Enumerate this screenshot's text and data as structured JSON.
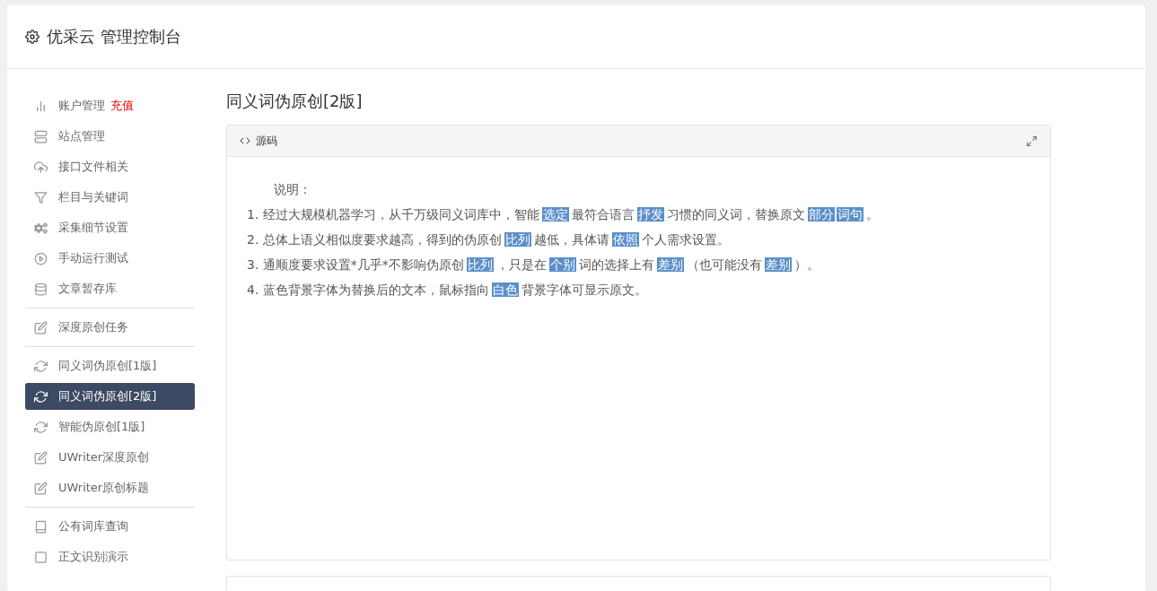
{
  "header": {
    "title": "优采云 管理控制台"
  },
  "sidebar": {
    "groups": [
      {
        "items": [
          {
            "label": "账户管理",
            "badge": "充值",
            "selected": false
          },
          {
            "label": "站点管理",
            "selected": false
          },
          {
            "label": "接口文件相关",
            "selected": false
          },
          {
            "label": "栏目与关键词",
            "selected": false
          },
          {
            "label": "采集细节设置",
            "selected": false
          },
          {
            "label": "手动运行测试",
            "selected": false
          },
          {
            "label": "文章暂存库",
            "selected": false
          }
        ]
      },
      {
        "items": [
          {
            "label": "深度原创任务",
            "selected": false
          }
        ]
      },
      {
        "items": [
          {
            "label": "同义词伪原创[1版]",
            "selected": false
          },
          {
            "label": "同义词伪原创[2版]",
            "selected": true
          },
          {
            "label": "智能伪原创[1版]",
            "selected": false
          },
          {
            "label": "UWriter深度原创",
            "selected": false
          },
          {
            "label": "UWriter原创标题",
            "selected": false
          }
        ]
      },
      {
        "items": [
          {
            "label": "公有词库查询",
            "selected": false
          },
          {
            "label": "正文识别演示",
            "selected": false
          }
        ]
      }
    ]
  },
  "page_title": "同义词伪原创[2版]",
  "panel": {
    "tab": "源码",
    "heading": "说明：",
    "lines": [
      [
        {
          "text": "1. 经过大规模机器学习，从千万级同义词库中，智能",
          "replaced": false
        },
        {
          "text": "选定",
          "replaced": true
        },
        {
          "text": "最符合语言",
          "replaced": false
        },
        {
          "text": "抒发",
          "replaced": true
        },
        {
          "text": "习惯的同义词，替换原文",
          "replaced": false
        },
        {
          "text": "部分",
          "replaced": true
        },
        {
          "text": "词句",
          "replaced": true
        },
        {
          "text": "。",
          "replaced": false
        }
      ],
      [
        {
          "text": "2. 总体上语义相似度要求越高，得到的伪原创",
          "replaced": false
        },
        {
          "text": "比列",
          "replaced": true
        },
        {
          "text": "越低，具体请",
          "replaced": false
        },
        {
          "text": "依照",
          "replaced": true
        },
        {
          "text": "个人需求设置。",
          "replaced": false
        }
      ],
      [
        {
          "text": "3. 通顺度要求设置*几乎*不影响伪原创",
          "replaced": false
        },
        {
          "text": "比列",
          "replaced": true
        },
        {
          "text": "，只是在",
          "replaced": false
        },
        {
          "text": "个别",
          "replaced": true
        },
        {
          "text": "词的选择上有",
          "replaced": false
        },
        {
          "text": "差别",
          "replaced": true
        },
        {
          "text": "（也可能没有",
          "replaced": false
        },
        {
          "text": "差别",
          "replaced": true
        },
        {
          "text": "）。",
          "replaced": false
        }
      ],
      [
        {
          "text": "4. 蓝色背景字体为替换后的文本，鼠标指向",
          "replaced": false
        },
        {
          "text": "白色",
          "replaced": true
        },
        {
          "text": "背景字体可显示原文。",
          "replaced": false
        }
      ]
    ]
  }
}
